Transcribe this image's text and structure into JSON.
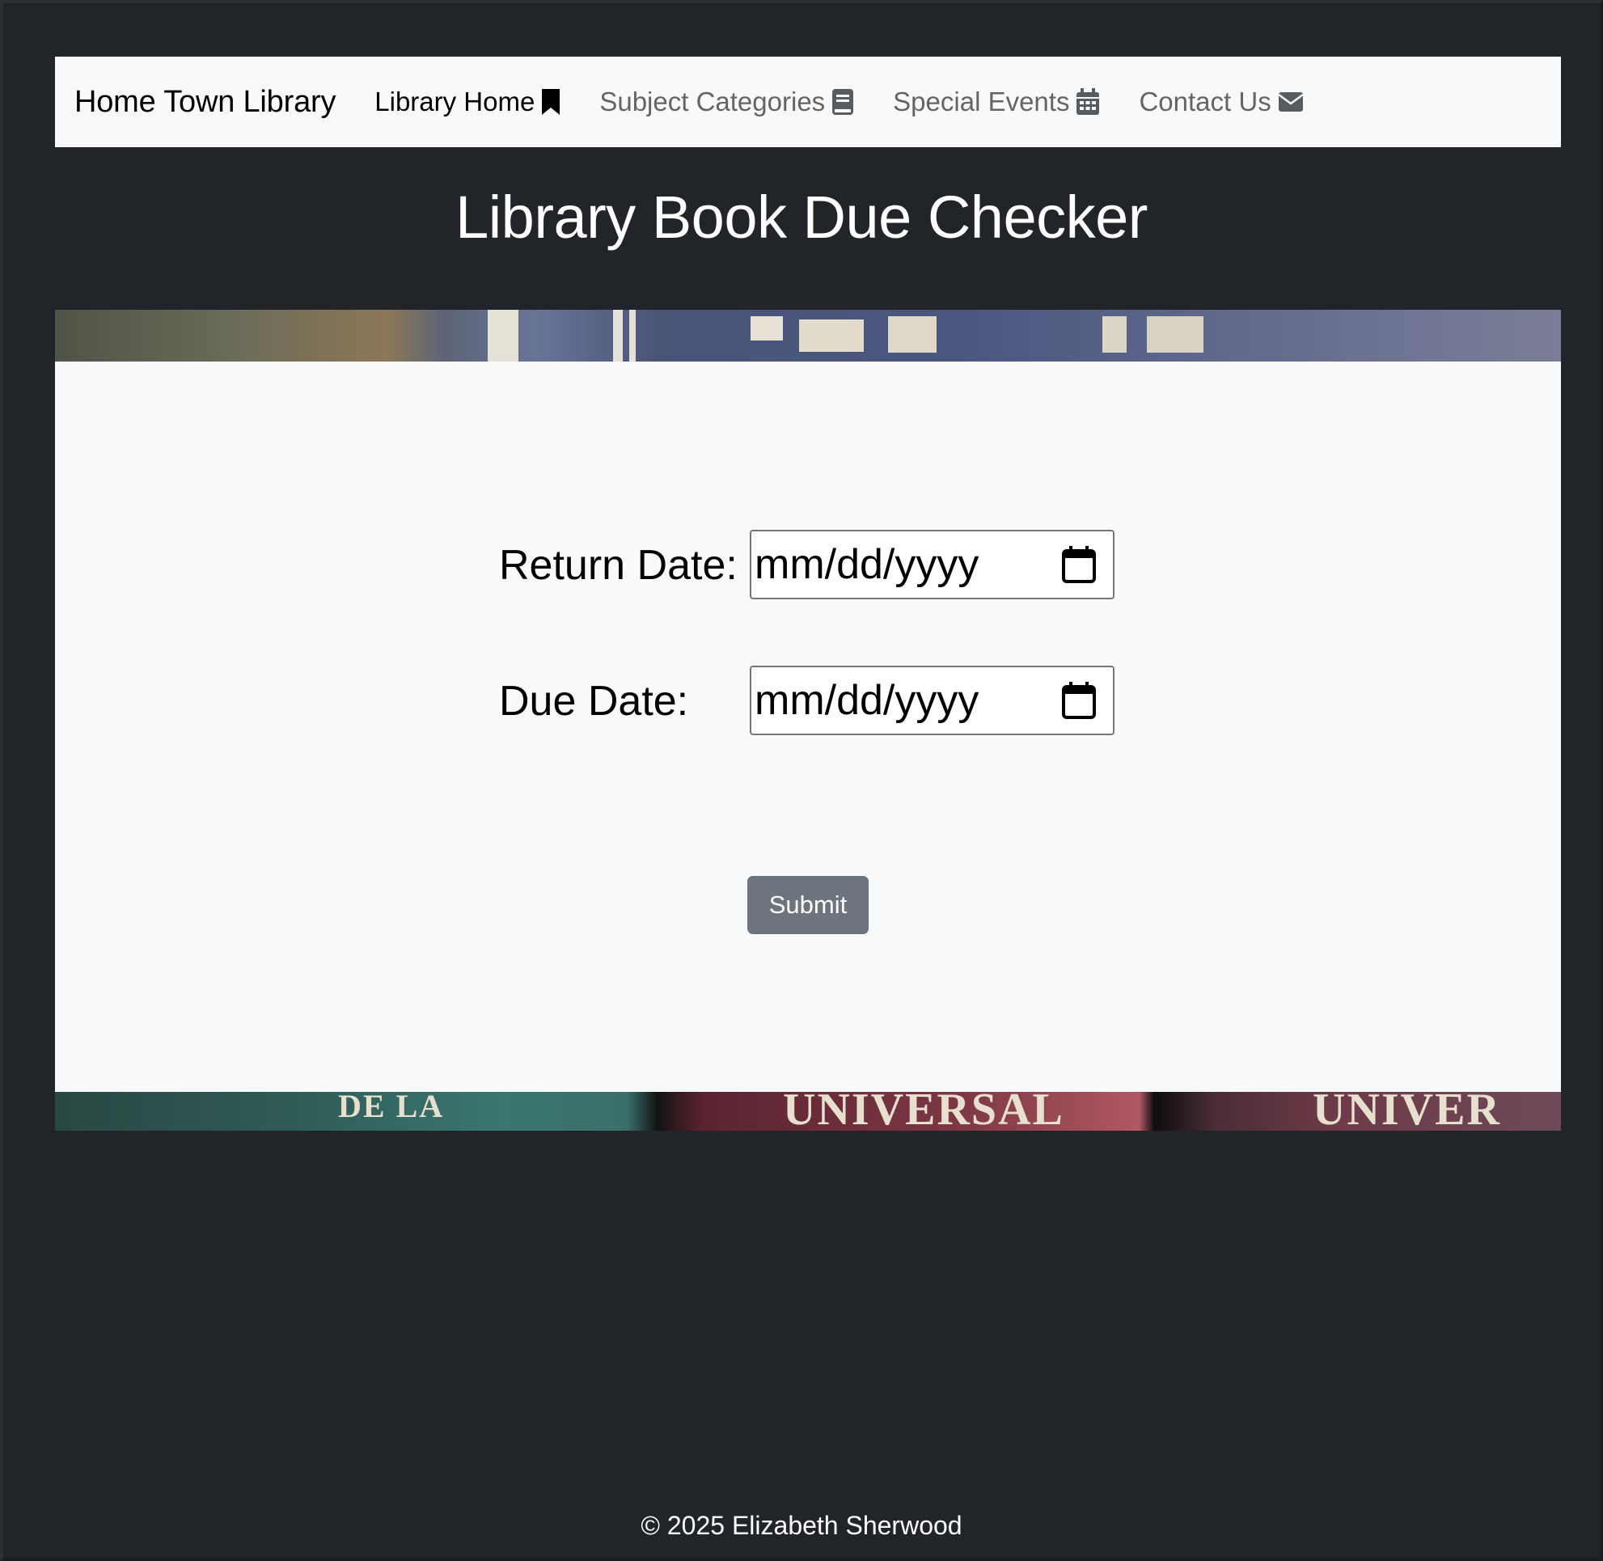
{
  "navbar": {
    "brand": "Home Town Library",
    "items": [
      {
        "label": "Library Home",
        "icon": "bookmark-icon",
        "active": true
      },
      {
        "label": "Subject Categories",
        "icon": "book-icon",
        "active": false
      },
      {
        "label": "Special Events",
        "icon": "calendar-icon",
        "active": false
      },
      {
        "label": "Contact Us",
        "icon": "envelope-icon",
        "active": false
      }
    ]
  },
  "page": {
    "title": "Library Book Due Checker"
  },
  "decor": {
    "top_strip_text": "",
    "bottom_strip_texts": [
      "DE LA",
      "UNIVERSAL",
      "UNIVER"
    ]
  },
  "form": {
    "return_date": {
      "label": "Return Date:",
      "placeholder": "mm/dd/yyyy",
      "value": ""
    },
    "due_date": {
      "label": "Due Date:",
      "placeholder": "mm/dd/yyyy",
      "value": ""
    },
    "submit_label": "Submit"
  },
  "footer": {
    "text": "© 2025 Elizabeth Sherwood"
  },
  "colors": {
    "background": "#212529",
    "navbar_bg": "#f8f9fa",
    "card_bg": "#f8f9fa",
    "button_bg": "#6c757d"
  }
}
